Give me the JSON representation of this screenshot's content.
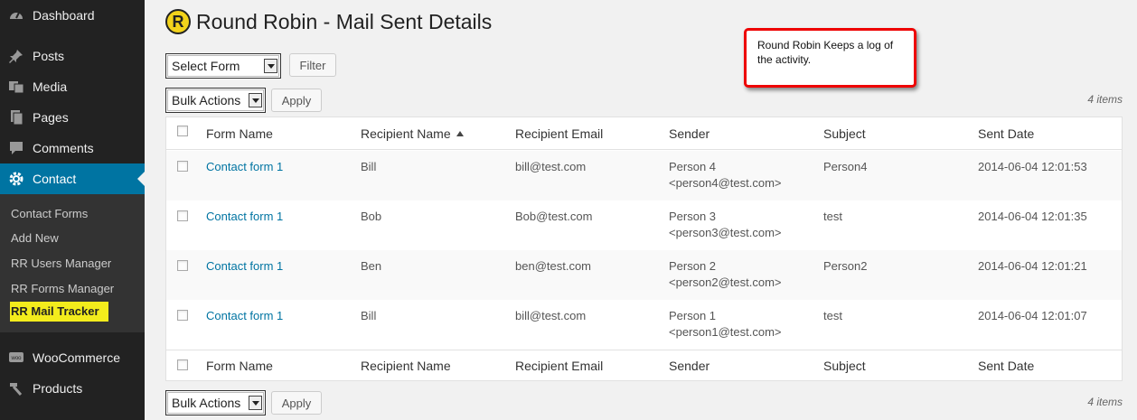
{
  "sidebar": {
    "items": [
      {
        "label": "Dashboard",
        "icon": "dashboard-icon"
      },
      {
        "label": "Posts",
        "icon": "pin-icon"
      },
      {
        "label": "Media",
        "icon": "media-icon"
      },
      {
        "label": "Pages",
        "icon": "pages-icon"
      },
      {
        "label": "Comments",
        "icon": "comment-icon"
      },
      {
        "label": "Contact",
        "icon": "gear-icon",
        "active": true
      },
      {
        "label": "WooCommerce",
        "icon": "woo-icon"
      },
      {
        "label": "Products",
        "icon": "hammer-icon"
      }
    ],
    "submenu": [
      "Contact Forms",
      "Add New",
      "RR Users Manager",
      "RR Forms Manager",
      "RR Mail Tracker"
    ],
    "highlight_color": "#f3ec1c",
    "active_color": "#0074a2"
  },
  "header": {
    "logo_letter": "R",
    "title": "Round Robin - Mail Sent Details"
  },
  "filters": {
    "form_select": "Select Form",
    "filter_button": "Filter",
    "bulk_select": "Bulk Actions",
    "apply_button": "Apply",
    "items_count": "4 items"
  },
  "callout": {
    "text": "Round Robin Keeps a log of the activity.",
    "border_color": "#ee0000"
  },
  "table": {
    "columns": [
      "Form Name",
      "Recipient Name",
      "Recipient Email",
      "Sender",
      "Subject",
      "Sent Date"
    ],
    "rows": [
      {
        "form": "Contact form 1",
        "recipient": "Bill",
        "email": "bill@test.com",
        "sender_name": "Person 4",
        "sender_email": "<person4@test.com>",
        "subject": "Person4",
        "date": "2014-06-04 12:01:53"
      },
      {
        "form": "Contact form 1",
        "recipient": "Bob",
        "email": "Bob@test.com",
        "sender_name": "Person 3",
        "sender_email": "<person3@test.com>",
        "subject": "test",
        "date": "2014-06-04 12:01:35"
      },
      {
        "form": "Contact form 1",
        "recipient": "Ben",
        "email": "ben@test.com",
        "sender_name": "Person 2",
        "sender_email": "<person2@test.com>",
        "subject": "Person2",
        "date": "2014-06-04 12:01:21"
      },
      {
        "form": "Contact form 1",
        "recipient": "Bill",
        "email": "bill@test.com",
        "sender_name": "Person 1",
        "sender_email": "<person1@test.com>",
        "subject": "test",
        "date": "2014-06-04 12:01:07"
      }
    ]
  }
}
